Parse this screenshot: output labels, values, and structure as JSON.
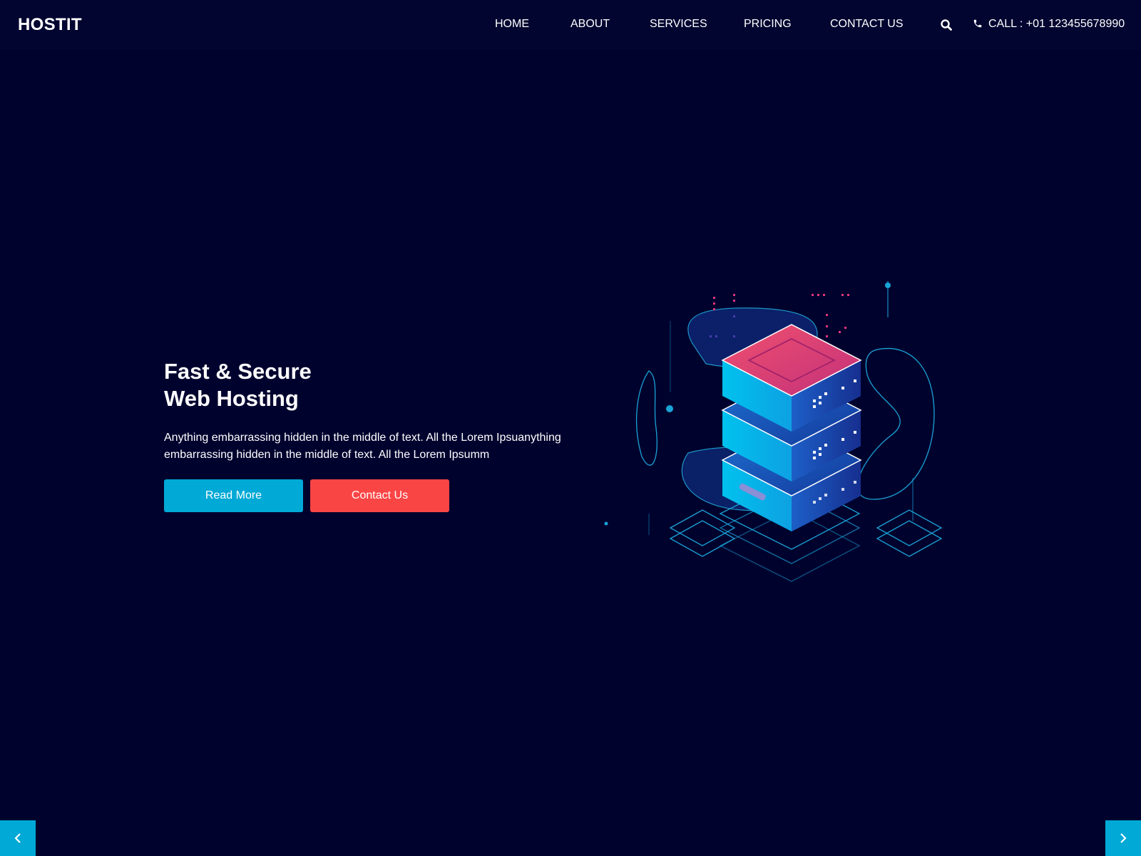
{
  "brand": {
    "name": "HOSTIT"
  },
  "nav": {
    "items": [
      {
        "label": "HOME"
      },
      {
        "label": "ABOUT"
      },
      {
        "label": "SERVICES"
      },
      {
        "label": "PRICING"
      },
      {
        "label": "CONTACT US"
      }
    ],
    "search_icon": "search-icon",
    "call_icon": "phone-icon",
    "call_text": "CALL : +01 123455678990"
  },
  "hero": {
    "title_line1": "Fast & Secure",
    "title_line2": "Web Hosting",
    "description": "Anything embarrassing hidden in the middle of text. All the Lorem Ipsuanything embarrassing hidden in the middle of text. All the Lorem Ipsumm",
    "read_more_label": "Read More",
    "contact_label": "Contact Us",
    "illustration_icon": "server-stack-illustration"
  },
  "slider": {
    "prev_icon": "chevron-left-icon",
    "next_icon": "chevron-right-icon"
  },
  "colors": {
    "background": "#00022e",
    "header": "#010530",
    "accent_blue": "#00a9d6",
    "accent_red": "#fa4545",
    "server_pink": "#e8456f",
    "server_cyan": "#00b8e6",
    "server_navy": "#1a3a9e"
  }
}
